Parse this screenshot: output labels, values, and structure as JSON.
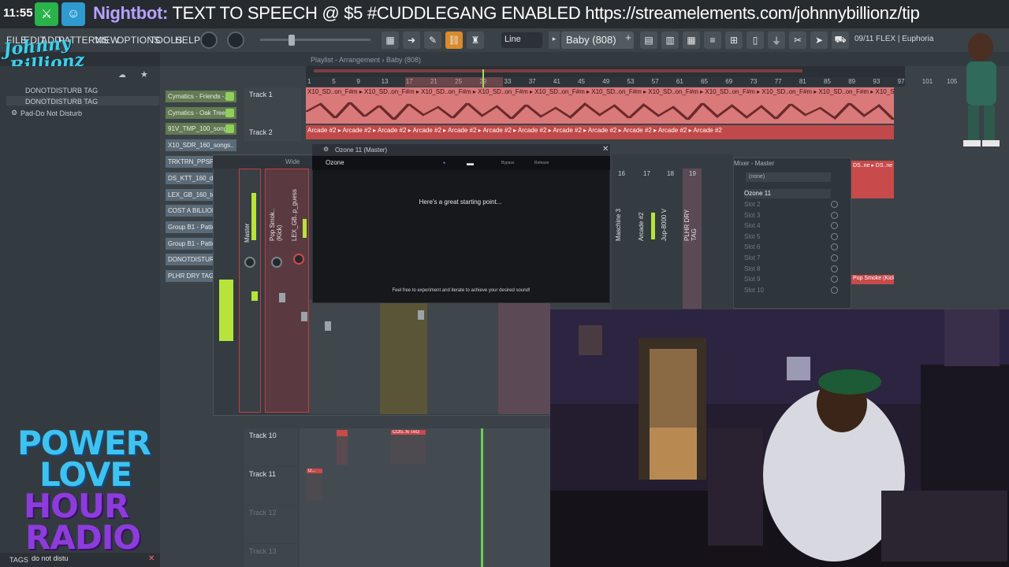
{
  "stream": {
    "clock": "11:55",
    "ticker_name": "Nightbot:",
    "ticker_text": " TEXT TO SPEECH @ $5 #CUDDLEGANG ENABLED https://streamelements.com/johnnybillionz/tip",
    "logo_line1": "Johnny",
    "logo_line2": "Billionz"
  },
  "menu": {
    "items": [
      "FILE",
      "EDIT",
      "ADD",
      "PATTERNS",
      "VIEW",
      "OPTIONS",
      "TOOLS",
      "HELP"
    ],
    "snap": "Line",
    "pattern": "Baby (808)",
    "hint": "09/11  FLEX | Euphoria"
  },
  "browser": {
    "items": [
      "DONOTDISTURB TAG",
      "DONOTDISTURB TAG",
      "Pad-Do Not Disturb"
    ],
    "search_value": "do not distu",
    "tags_label": "TAGS"
  },
  "channels": [
    {
      "label": "Cymatics - Friends -..",
      "green": true
    },
    {
      "label": "Cymatics - Oak Tree..",
      "green": true
    },
    {
      "label": "91V_TMP_100_song..",
      "green": true
    },
    {
      "label": "X10_SDR_160_songs..",
      "green": false
    },
    {
      "label": "TRKTRN_PPSPBPX",
      "green": false
    },
    {
      "label": "DS_KTT_160_drur",
      "green": false
    },
    {
      "label": "LEX_GB_160_top",
      "green": false
    },
    {
      "label": "COST A BILLION TA",
      "green": false
    },
    {
      "label": "Group B1 - Patter",
      "green": false
    },
    {
      "label": "Group B1 - Patter",
      "green": false
    },
    {
      "label": "DONOTDISTURB TA",
      "green": false
    },
    {
      "label": "PLHR DRY TAG",
      "green": false
    }
  ],
  "playlist": {
    "title": "Playlist - Arrangement › Baby (808)",
    "ticks": [
      "1",
      "5",
      "9",
      "13",
      "17",
      "21",
      "25",
      "29",
      "33",
      "37",
      "41",
      "45",
      "49",
      "53",
      "57",
      "61",
      "65",
      "69",
      "73",
      "77",
      "81",
      "85",
      "89",
      "93",
      "97",
      "101",
      "105"
    ],
    "tracks": [
      "Track 1",
      "Track 2",
      "Track 10",
      "Track 11",
      "Track 12",
      "Track 13"
    ],
    "clip1_label": "X10_SD..on_F#m ▸ X10_SD..on_F#m ▸ X10_SD..on_F#m ▸ X10_SD..on_F#m ▸ X10_SD..on_F#m ▸ X10_SD..on_F#m ▸ X10_SD..on_F#m ▸ X10_SD..on_F#m ▸ X10_SD..on_F#m ▸ X10_SD..on_F#m ▸ X10_SD..on_F#m ▸ X10_SD..on_F#m",
    "clip2_label": "Arcade #2 ▸ Arcade #2 ▸ Arcade #2 ▸ Arcade #2 ▸ Arcade #2 ▸ Arcade #2 ▸ Arcade #2 ▸ Arcade #2 ▸ Arcade #2 ▸ Arcade #2 ▸ Arcade #2 ▸ Arcade #2",
    "clip_ds": "DS..ne ▸ DS..ne",
    "clip_pop": "Pop Smoke (Kick)",
    "clip_cos": "COS..N TAG",
    "clip_d": "D..."
  },
  "mixer": {
    "title": "Wide",
    "strip_labels": [
      "Master",
      "Pop Smok..(Kick)",
      "LEX_GB..p_guess"
    ],
    "right_strip_numbers": [
      "16",
      "17",
      "18",
      "19"
    ],
    "right_strip_labels": [
      "Maschine 3",
      "Arcade #2",
      "Jup-8000 V",
      "PLHR DRY TAG"
    ],
    "master_title": "Mixer - Master",
    "preset": "(none)",
    "slot_active": "Ozone 11",
    "slots": [
      "Slot 2",
      "Slot 3",
      "Slot 4",
      "Slot 5",
      "Slot 6",
      "Slot 7",
      "Slot 8",
      "Slot 9",
      "Slot 10"
    ]
  },
  "ozone": {
    "window_title": "Ozone 11 (Master)",
    "brand": "Ozone",
    "tab_bypass": "Bypass",
    "tab_release": "Release",
    "headline": "Here's a great starting point...",
    "footer": "Feel free to experiment and iterate to achieve your desired sound!"
  },
  "overlay": {
    "power": "POWER",
    "love": "LOVE",
    "hour": "HOUR",
    "radio": "RADIO"
  },
  "colors": {
    "accent_pink": "#d9797a",
    "accent_red": "#c24949",
    "channel_green": "#637a52",
    "overlay_cyan": "#3ec3f0",
    "overlay_purple": "#8d3cdc"
  }
}
